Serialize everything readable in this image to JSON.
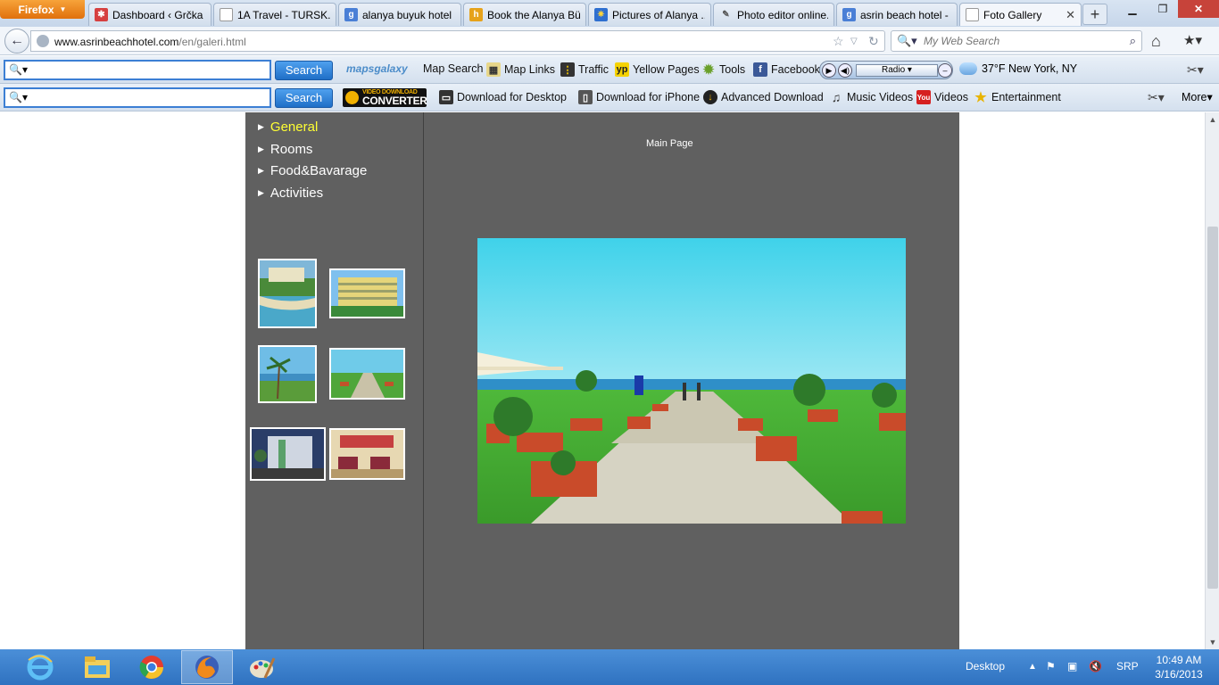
{
  "browser": {
    "menu_button": "Firefox",
    "tabs": [
      {
        "label": "Dashboard ‹ Grčka ...",
        "icon": "wordpress-icon",
        "color": "#d64040"
      },
      {
        "label": "1A Travel  - TURSK...",
        "icon": "blank-page-icon",
        "color": "#dddddd"
      },
      {
        "label": "alanya buyuk hotel ...",
        "icon": "google-icon",
        "color": "#4a7fd6"
      },
      {
        "label": "Book the Alanya Bü...",
        "icon": "hotels-icon",
        "color": "#e6a21a"
      },
      {
        "label": "Pictures of Alanya ...",
        "icon": "star-icon",
        "color": "#2e6fd0"
      },
      {
        "label": "Photo editor online...",
        "icon": "pencil-icon",
        "color": "#666666"
      },
      {
        "label": "asrin beach hotel - ...",
        "icon": "google-icon",
        "color": "#4a7fd6"
      },
      {
        "label": "Foto Gallery",
        "icon": "blank-page-icon",
        "color": "#dddddd",
        "active": true
      }
    ],
    "new_tab": "+",
    "url_domain": "www.asrinbeachhotel.com",
    "url_path": "/en/galeri.html",
    "search_placeholder": "My Web Search"
  },
  "toolbar1": {
    "search_button": "Search",
    "logo": "mapsgalaxy",
    "items": [
      "Map Search",
      "Map Links",
      "Traffic",
      "Yellow Pages",
      "Tools",
      "Facebook"
    ],
    "radio_label": "Radio",
    "weather": "37°F New York, NY"
  },
  "toolbar2": {
    "search_button": "Search",
    "logo_top": "VIDEO DOWNLOAD",
    "logo_bottom": "CONVERTER",
    "items": [
      "Download for Desktop",
      "Download for iPhone",
      "Advanced Download",
      "Music Videos",
      "Videos",
      "Entertainment"
    ],
    "more": "More"
  },
  "site": {
    "menu": [
      {
        "label": "General",
        "active": true
      },
      {
        "label": "Rooms"
      },
      {
        "label": "Food&Bavarage"
      },
      {
        "label": "Activities"
      }
    ],
    "main_page_link": "Main Page",
    "thumbnails": [
      "hotel-aerial-beach",
      "hotel-building-pool",
      "palm-beach",
      "garden-path-sea",
      "hotel-night-facade",
      "hotel-lobby"
    ],
    "colors": {
      "panel": "#606060",
      "accent": "#ffff33",
      "rule": "#3a2fb3"
    }
  },
  "taskbar": {
    "desktop": "Desktop",
    "language": "SRP",
    "time": "10:49 AM",
    "date": "3/16/2013"
  }
}
